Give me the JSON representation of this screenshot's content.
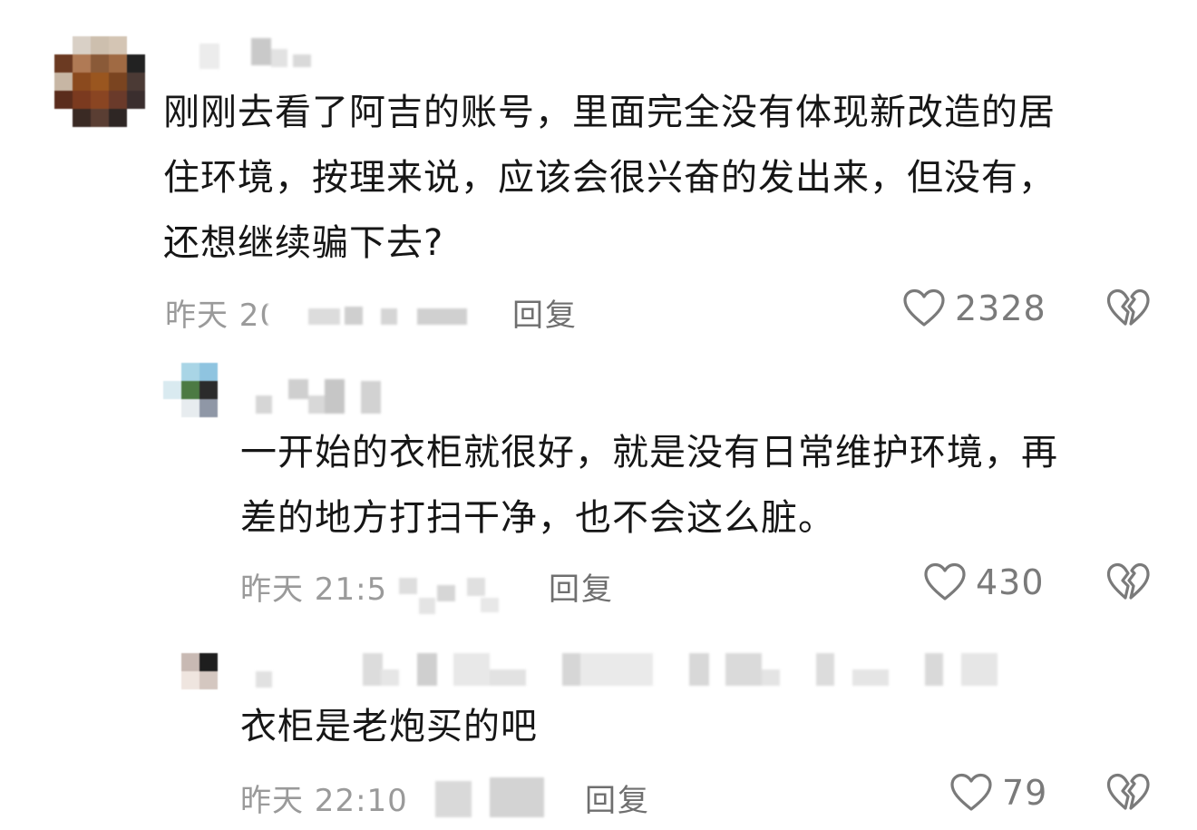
{
  "comments": [
    {
      "text_lines": [
        "刚刚去看了阿吉的账号，里面完全没有体现新改造的居",
        "住环境，按理来说，应该会很兴奋的发出来，但没有，",
        "还想继续骗下去?"
      ],
      "time": "昨天 20",
      "reply_label": "回复",
      "likes": "2328"
    },
    {
      "text_lines": [
        "一开始的衣柜就很好，就是没有日常维护环境，再",
        "差的地方打扫干净，也不会这么脏。"
      ],
      "time": "昨天 21:5",
      "reply_label": "回复",
      "likes": "430"
    },
    {
      "text_lines": [
        "衣柜是老炮买的吧"
      ],
      "time": "昨天 22:10",
      "reply_label": "回复",
      "likes": "79"
    }
  ],
  "icons": {
    "like": "heart-outline-icon",
    "dislike": "broken-heart-icon"
  },
  "colors": {
    "text": "#161616",
    "meta": "#9a9a9a",
    "reply": "#6f6f6f",
    "icon": "#7a7a7a"
  }
}
